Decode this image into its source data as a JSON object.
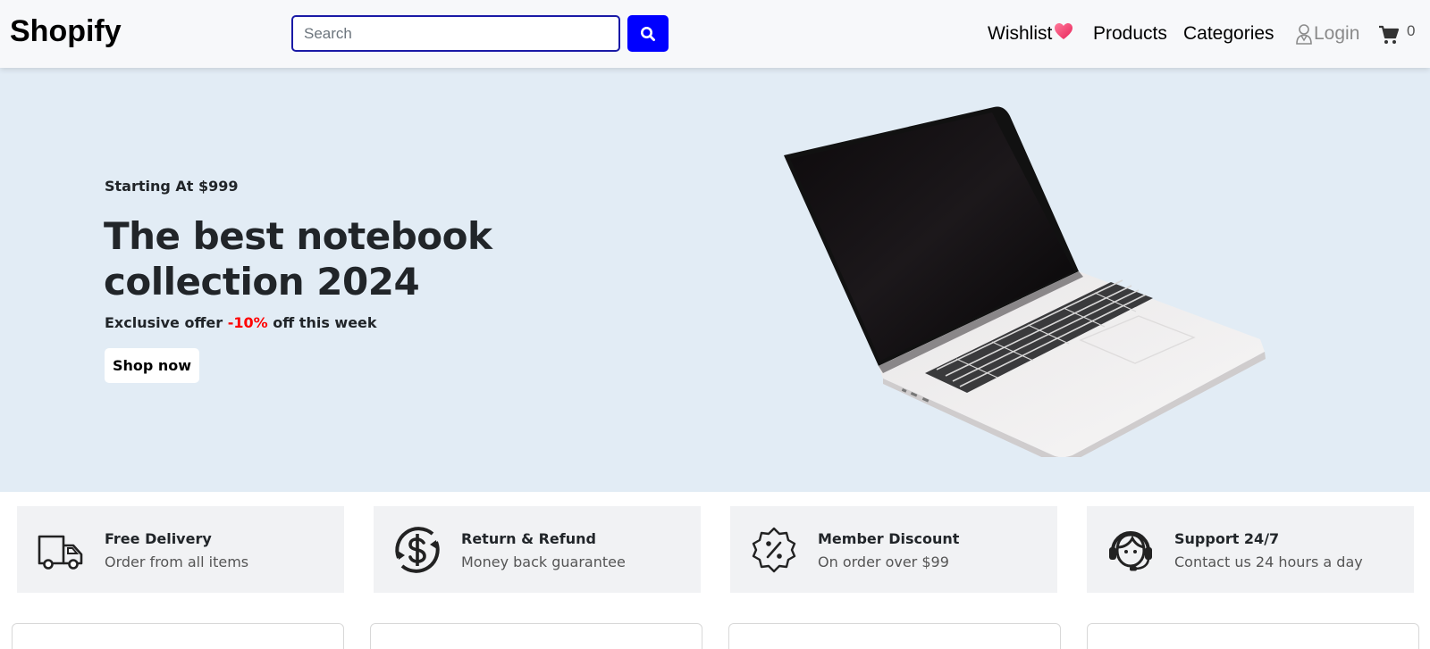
{
  "header": {
    "logo": "Shopify",
    "search": {
      "placeholder": "Search",
      "value": "",
      "button_icon": "search-icon"
    },
    "nav": {
      "wishlist": "Wishlist",
      "wishlist_icon": "heart-icon",
      "products": "Products",
      "categories": "Categories",
      "login": "Login",
      "login_icon": "user-icon",
      "cart_icon": "cart-icon",
      "cart_count": "0"
    }
  },
  "hero": {
    "eyebrow": "Starting At $999",
    "title": "The best notebook collection 2024",
    "offer_prefix": "Exclusive offer",
    "offer_discount": "-10%",
    "offer_suffix": "off this week",
    "cta": "Shop now",
    "image": "laptop-image"
  },
  "features": [
    {
      "icon": "truck-icon",
      "title": "Free Delivery",
      "subtitle": "Order from all items"
    },
    {
      "icon": "refund-dollar-icon",
      "title": "Return & Refund",
      "subtitle": "Money back guarantee"
    },
    {
      "icon": "discount-badge-icon",
      "title": "Member Discount",
      "subtitle": "On order over $99"
    },
    {
      "icon": "headset-support-icon",
      "title": "Support 24/7",
      "subtitle": "Contact us 24 hours a day"
    }
  ],
  "colors": {
    "accent": "#0000ff",
    "hero_bg": "#e2ecf5",
    "discount": "#ff0000",
    "header_bg": "#f7f8fa",
    "feature_bg": "#f1f2f4"
  }
}
